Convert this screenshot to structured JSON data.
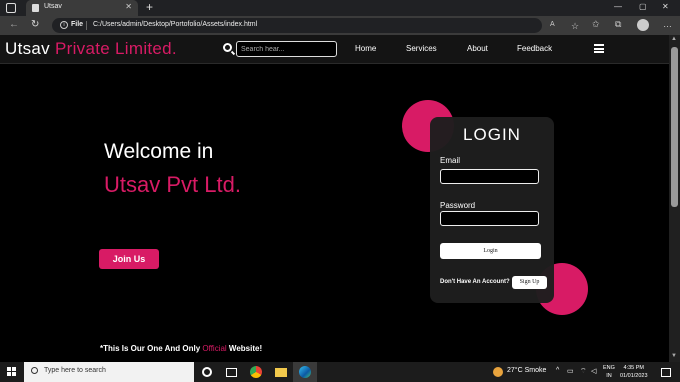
{
  "browser": {
    "tab_title": "Utsav",
    "url_scheme": "File",
    "url": "C:/Users/admin/Desktop/Portofolio/Assets/index.html"
  },
  "site": {
    "brand_white": "Utsav",
    "brand_pink": "Private Limited.",
    "search_placeholder": "Search hear...",
    "nav": [
      "Home",
      "Services",
      "About",
      "Feedback"
    ],
    "welcome": "Welcome in",
    "company": "Utsav Pvt Ltd.",
    "join_label": "Join Us",
    "note_before": "*This Is Our One And Only ",
    "note_pink": "Official",
    "note_after": " Website!"
  },
  "login": {
    "title": "LOGIN",
    "email_label": "Email",
    "password_label": "Password",
    "login_button": "Login",
    "no_account": "Don't Have An Account?",
    "signup_button": "Sign Up"
  },
  "taskbar": {
    "search_placeholder": "Type here to search",
    "weather": "27°C  Smoke",
    "lang_top": "ENG",
    "lang_bottom": "IN",
    "time": "4:35 PM",
    "date": "01/01/2023"
  },
  "colors": {
    "accent": "#d81b65",
    "background": "#000000"
  }
}
